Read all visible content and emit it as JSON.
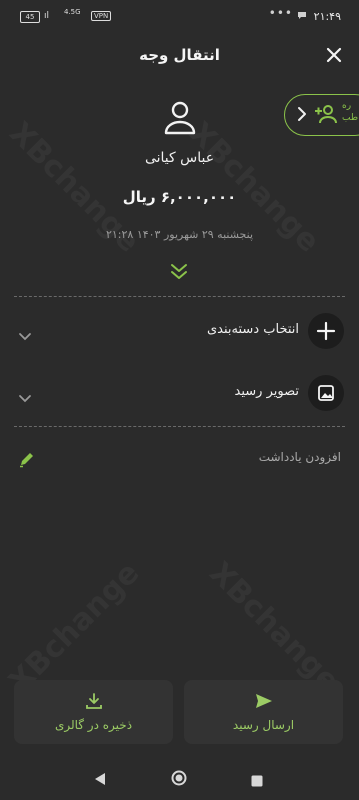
{
  "status_bar": {
    "time": "۲۱:۴۹",
    "battery": "45",
    "signal": "ıl",
    "network": "4.5G",
    "vpn": "VPN",
    "dots": "•••"
  },
  "header": {
    "title": "انتقال وجه"
  },
  "pill": {
    "text_line1": "ره",
    "text_line2": "طب"
  },
  "contact": {
    "name": "عباس کیانی",
    "amount": "۶,۰۰۰,۰۰۰ ریال",
    "datetime": "پنجشنبه ۲۹ شهریور ۱۴۰۳   ۲۱:۲۸"
  },
  "rows": {
    "category_label": "انتخاب دسته‌بندی",
    "receipt_label": "تصویر رسید"
  },
  "note": {
    "placeholder": "افزودن یادداشت"
  },
  "watermark": "XBchange",
  "buttons": {
    "save_gallery": "ذخیره در گالری",
    "send_receipt": "ارسال رسید"
  },
  "colors": {
    "accent": "#8bc34a",
    "background": "#2b2b2b",
    "button_bg": "#333333"
  }
}
